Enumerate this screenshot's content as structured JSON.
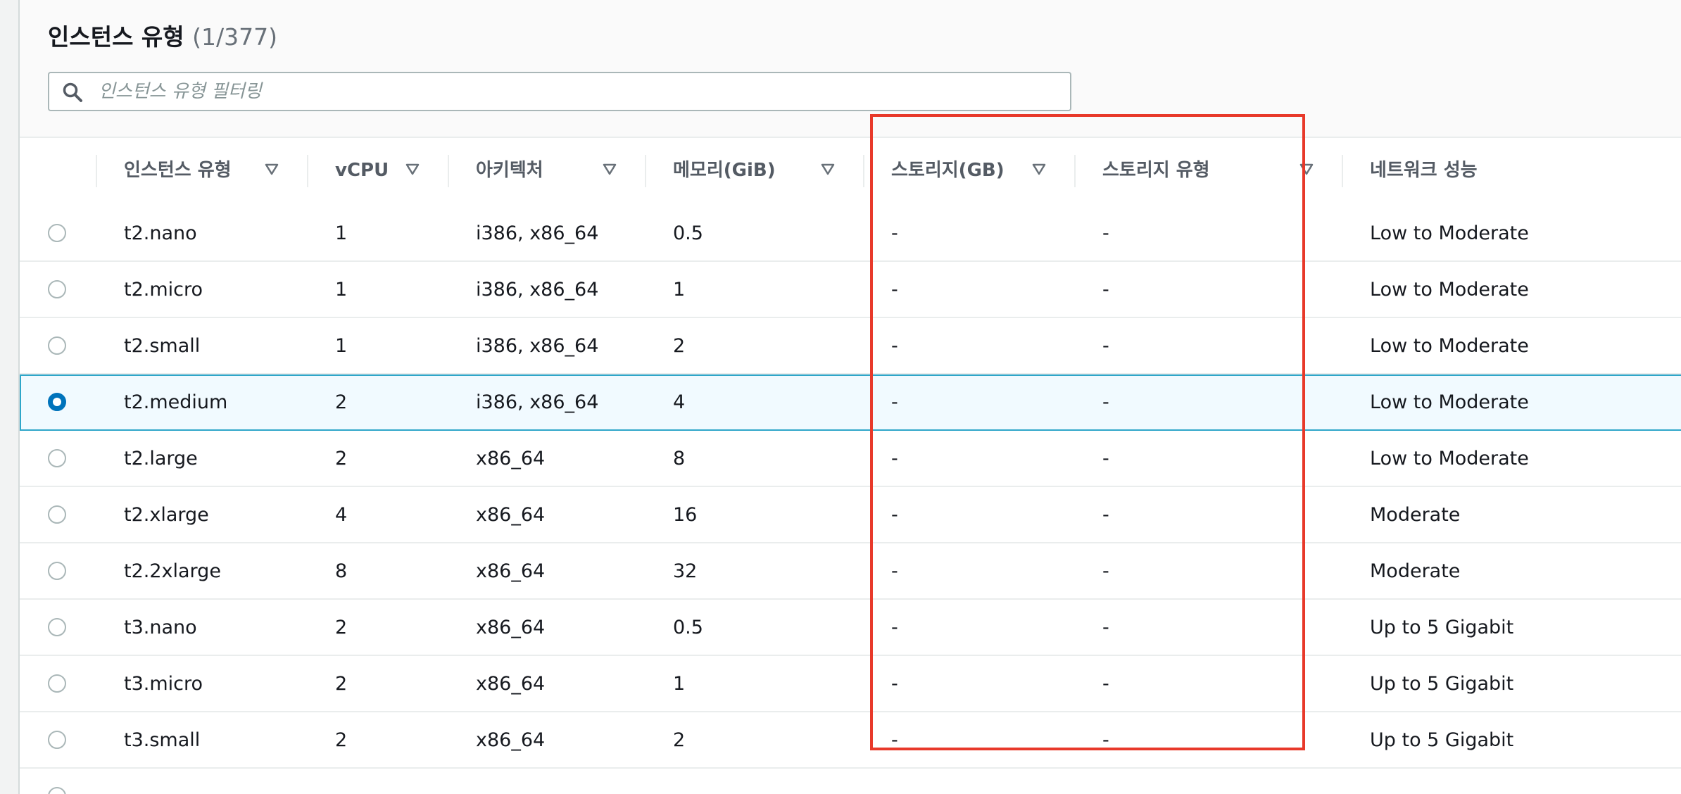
{
  "header": {
    "title": "인스턴스 유형",
    "count": "(1/377)"
  },
  "search": {
    "placeholder": "인스턴스 유형 필터링",
    "value": ""
  },
  "columns": [
    "인스턴스 유형",
    "vCPU",
    "아키텍처",
    "메모리(GiB)",
    "스토리지(GB)",
    "스토리지 유형",
    "네트워크 성능"
  ],
  "rows": [
    {
      "type": "t2.nano",
      "vcpu": "1",
      "arch": "i386, x86_64",
      "memory": "0.5",
      "storage": "-",
      "storage_type": "-",
      "network": "Low to Moderate",
      "selected": false
    },
    {
      "type": "t2.micro",
      "vcpu": "1",
      "arch": "i386, x86_64",
      "memory": "1",
      "storage": "-",
      "storage_type": "-",
      "network": "Low to Moderate",
      "selected": false
    },
    {
      "type": "t2.small",
      "vcpu": "1",
      "arch": "i386, x86_64",
      "memory": "2",
      "storage": "-",
      "storage_type": "-",
      "network": "Low to Moderate",
      "selected": false
    },
    {
      "type": "t2.medium",
      "vcpu": "2",
      "arch": "i386, x86_64",
      "memory": "4",
      "storage": "-",
      "storage_type": "-",
      "network": "Low to Moderate",
      "selected": true
    },
    {
      "type": "t2.large",
      "vcpu": "2",
      "arch": "x86_64",
      "memory": "8",
      "storage": "-",
      "storage_type": "-",
      "network": "Low to Moderate",
      "selected": false
    },
    {
      "type": "t2.xlarge",
      "vcpu": "4",
      "arch": "x86_64",
      "memory": "16",
      "storage": "-",
      "storage_type": "-",
      "network": "Moderate",
      "selected": false
    },
    {
      "type": "t2.2xlarge",
      "vcpu": "8",
      "arch": "x86_64",
      "memory": "32",
      "storage": "-",
      "storage_type": "-",
      "network": "Moderate",
      "selected": false
    },
    {
      "type": "t3.nano",
      "vcpu": "2",
      "arch": "x86_64",
      "memory": "0.5",
      "storage": "-",
      "storage_type": "-",
      "network": "Up to 5 Gigabit",
      "selected": false
    },
    {
      "type": "t3.micro",
      "vcpu": "2",
      "arch": "x86_64",
      "memory": "1",
      "storage": "-",
      "storage_type": "-",
      "network": "Up to 5 Gigabit",
      "selected": false
    },
    {
      "type": "t3.small",
      "vcpu": "2",
      "arch": "x86_64",
      "memory": "2",
      "storage": "-",
      "storage_type": "-",
      "network": "Up to 5 Gigabit",
      "selected": false
    }
  ],
  "colors": {
    "selected_accent": "#0073bb",
    "selected_row_border": "#2fa6c9",
    "highlight_box": "#e8392a"
  }
}
